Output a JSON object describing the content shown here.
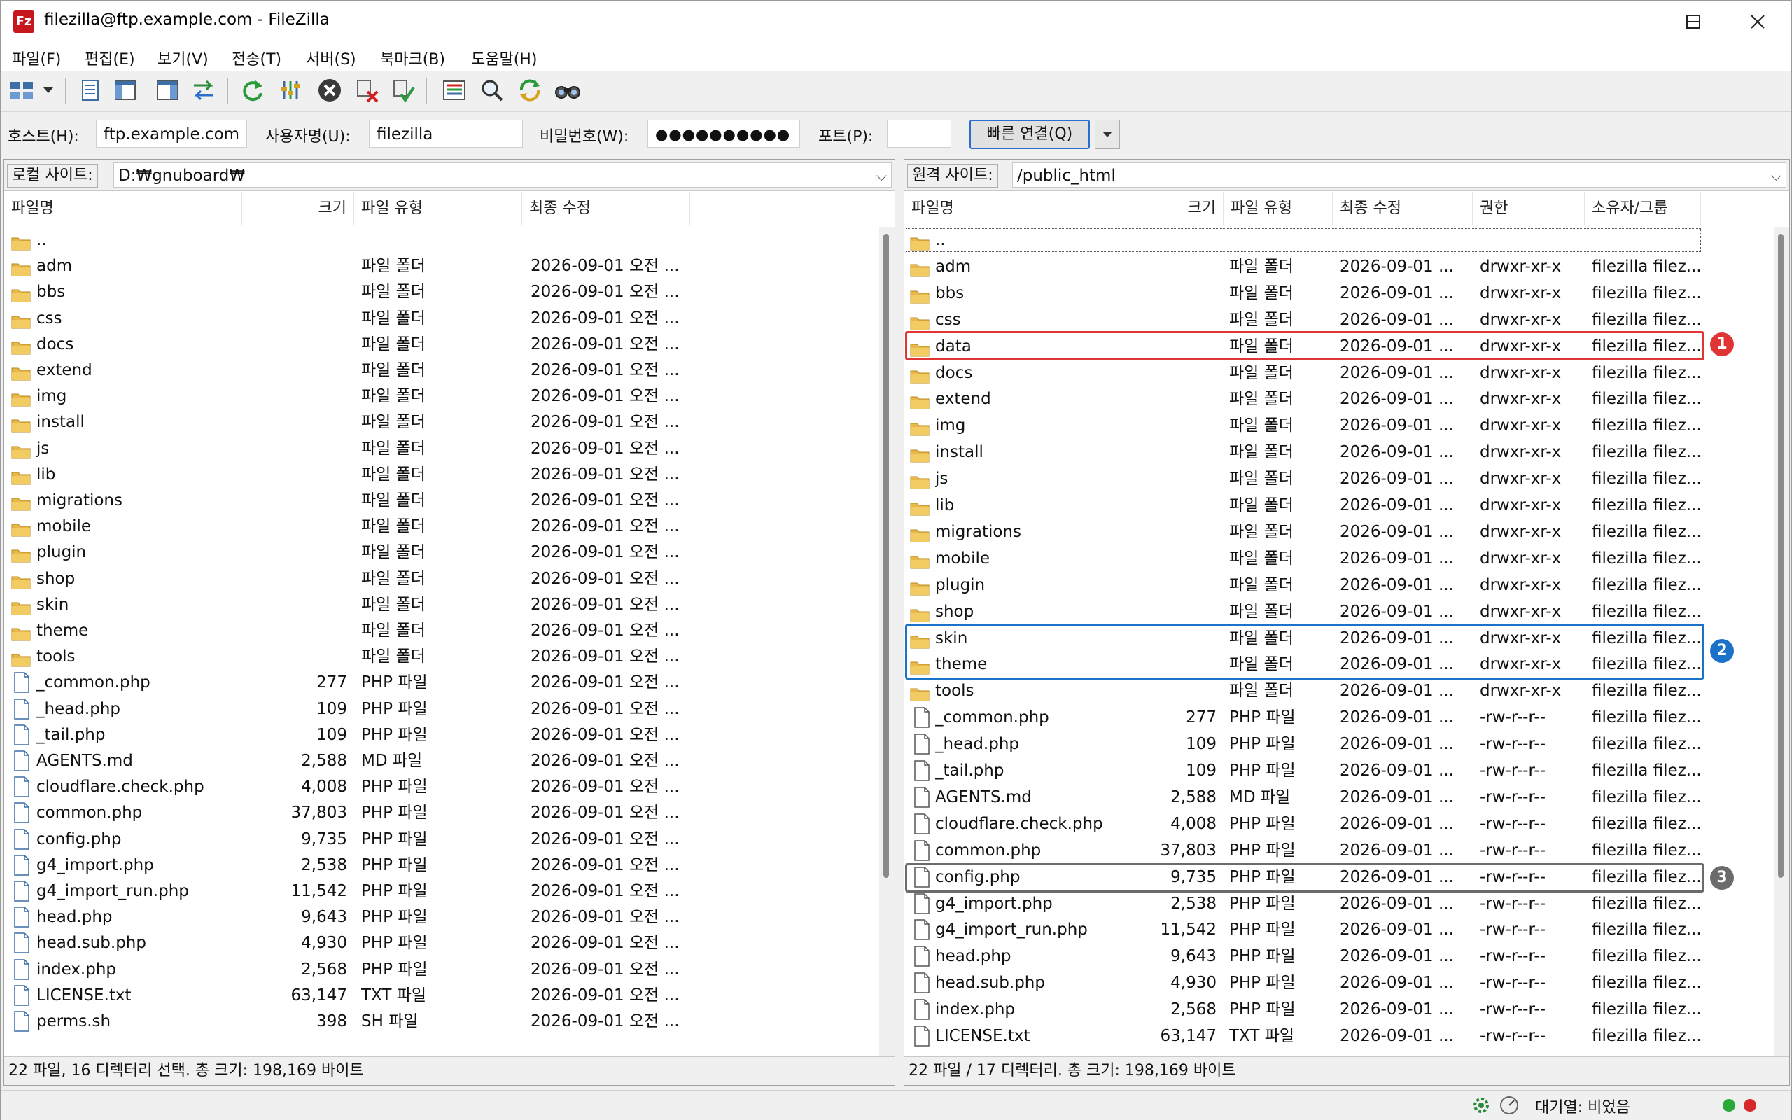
{
  "window": {
    "title": "filezilla@ftp.example.com - FileZilla",
    "app_icon_text": "Fz"
  },
  "menu": [
    "파일(F)",
    "편집(E)",
    "보기(V)",
    "전송(T)",
    "서버(S)",
    "북마크(B)",
    "도움말(H)"
  ],
  "toolbar": {
    "icons": [
      "site-manager-icon",
      "dropdown-arrow-icon",
      "message-log-icon",
      "local-tree-icon",
      "remote-tree-icon",
      "transfer-queue-icon",
      "refresh-icon",
      "filter-icon",
      "cancel-icon",
      "disconnect-icon",
      "reconnect-icon",
      "directory-compare-icon",
      "search-remote-icon",
      "sync-browse-icon",
      "find-files-icon"
    ]
  },
  "quickconnect": {
    "host_label": "호스트(H):",
    "host_value": "ftp.example.com",
    "user_label": "사용자명(U):",
    "user_value": "filezilla",
    "pass_label": "비밀번호(W):",
    "pass_value": "●●●●●●●●●●",
    "port_label": "포트(P):",
    "port_value": "",
    "connect_button": "빠른 연결(Q)"
  },
  "local": {
    "site_label": "로컬 사이트:",
    "path": "D:₩gnuboard₩",
    "columns": [
      "파일명",
      "크기",
      "파일 유형",
      "최종 수정"
    ],
    "rows": [
      {
        "name": "..",
        "type": "",
        "size": "",
        "kind": "",
        "modified": ""
      },
      {
        "name": "adm",
        "type": "folder",
        "size": "",
        "kind": "파일 폴더",
        "modified": "2026-09-01 오전 ..."
      },
      {
        "name": "bbs",
        "type": "folder",
        "size": "",
        "kind": "파일 폴더",
        "modified": "2026-09-01 오전 ..."
      },
      {
        "name": "css",
        "type": "folder",
        "size": "",
        "kind": "파일 폴더",
        "modified": "2026-09-01 오전 ..."
      },
      {
        "name": "docs",
        "type": "folder",
        "size": "",
        "kind": "파일 폴더",
        "modified": "2026-09-01 오전 ..."
      },
      {
        "name": "extend",
        "type": "folder",
        "size": "",
        "kind": "파일 폴더",
        "modified": "2026-09-01 오전 ..."
      },
      {
        "name": "img",
        "type": "folder",
        "size": "",
        "kind": "파일 폴더",
        "modified": "2026-09-01 오전 ..."
      },
      {
        "name": "install",
        "type": "folder",
        "size": "",
        "kind": "파일 폴더",
        "modified": "2026-09-01 오전 ..."
      },
      {
        "name": "js",
        "type": "folder",
        "size": "",
        "kind": "파일 폴더",
        "modified": "2026-09-01 오전 ..."
      },
      {
        "name": "lib",
        "type": "folder",
        "size": "",
        "kind": "파일 폴더",
        "modified": "2026-09-01 오전 ..."
      },
      {
        "name": "migrations",
        "type": "folder",
        "size": "",
        "kind": "파일 폴더",
        "modified": "2026-09-01 오전 ..."
      },
      {
        "name": "mobile",
        "type": "folder",
        "size": "",
        "kind": "파일 폴더",
        "modified": "2026-09-01 오전 ..."
      },
      {
        "name": "plugin",
        "type": "folder",
        "size": "",
        "kind": "파일 폴더",
        "modified": "2026-09-01 오전 ..."
      },
      {
        "name": "shop",
        "type": "folder",
        "size": "",
        "kind": "파일 폴더",
        "modified": "2026-09-01 오전 ..."
      },
      {
        "name": "skin",
        "type": "folder",
        "size": "",
        "kind": "파일 폴더",
        "modified": "2026-09-01 오전 ..."
      },
      {
        "name": "theme",
        "type": "folder",
        "size": "",
        "kind": "파일 폴더",
        "modified": "2026-09-01 오전 ..."
      },
      {
        "name": "tools",
        "type": "folder",
        "size": "",
        "kind": "파일 폴더",
        "modified": "2026-09-01 오전 ..."
      },
      {
        "name": "_common.php",
        "type": "file",
        "size": "277",
        "kind": "PHP 파일",
        "modified": "2026-09-01 오전 ..."
      },
      {
        "name": "_head.php",
        "type": "file",
        "size": "109",
        "kind": "PHP 파일",
        "modified": "2026-09-01 오전 ..."
      },
      {
        "name": "_tail.php",
        "type": "file",
        "size": "109",
        "kind": "PHP 파일",
        "modified": "2026-09-01 오전 ..."
      },
      {
        "name": "AGENTS.md",
        "type": "file",
        "size": "2,588",
        "kind": "MD 파일",
        "modified": "2026-09-01 오전 ..."
      },
      {
        "name": "cloudflare.check.php",
        "type": "file",
        "size": "4,008",
        "kind": "PHP 파일",
        "modified": "2026-09-01 오전 ..."
      },
      {
        "name": "common.php",
        "type": "file",
        "size": "37,803",
        "kind": "PHP 파일",
        "modified": "2026-09-01 오전 ..."
      },
      {
        "name": "config.php",
        "type": "file",
        "size": "9,735",
        "kind": "PHP 파일",
        "modified": "2026-09-01 오전 ..."
      },
      {
        "name": "g4_import.php",
        "type": "file",
        "size": "2,538",
        "kind": "PHP 파일",
        "modified": "2026-09-01 오전 ..."
      },
      {
        "name": "g4_import_run.php",
        "type": "file",
        "size": "11,542",
        "kind": "PHP 파일",
        "modified": "2026-09-01 오전 ..."
      },
      {
        "name": "head.php",
        "type": "file",
        "size": "9,643",
        "kind": "PHP 파일",
        "modified": "2026-09-01 오전 ..."
      },
      {
        "name": "head.sub.php",
        "type": "file",
        "size": "4,930",
        "kind": "PHP 파일",
        "modified": "2026-09-01 오전 ..."
      },
      {
        "name": "index.php",
        "type": "file",
        "size": "2,568",
        "kind": "PHP 파일",
        "modified": "2026-09-01 오전 ..."
      },
      {
        "name": "LICENSE.txt",
        "type": "file",
        "size": "63,147",
        "kind": "TXT 파일",
        "modified": "2026-09-01 오전 ..."
      },
      {
        "name": "perms.sh",
        "type": "file",
        "size": "398",
        "kind": "SH 파일",
        "modified": "2026-09-01 오전 ..."
      }
    ],
    "status": "22 파일, 16 디렉터리 선택. 총 크기: 198,169 바이트"
  },
  "remote": {
    "site_label": "원격 사이트:",
    "path": "/public_html",
    "columns": [
      "파일명",
      "크기",
      "파일 유형",
      "최종 수정",
      "권한",
      "소유자/그룹"
    ],
    "rows": [
      {
        "name": "..",
        "type": "folder",
        "size": "",
        "kind": "",
        "modified": "",
        "perm": "",
        "owner": ""
      },
      {
        "name": "adm",
        "type": "folder",
        "size": "",
        "kind": "파일 폴더",
        "modified": "2026-09-01 ...",
        "perm": "drwxr-xr-x",
        "owner": "filezilla filez..."
      },
      {
        "name": "bbs",
        "type": "folder",
        "size": "",
        "kind": "파일 폴더",
        "modified": "2026-09-01 ...",
        "perm": "drwxr-xr-x",
        "owner": "filezilla filez..."
      },
      {
        "name": "css",
        "type": "folder",
        "size": "",
        "kind": "파일 폴더",
        "modified": "2026-09-01 ...",
        "perm": "drwxr-xr-x",
        "owner": "filezilla filez..."
      },
      {
        "name": "data",
        "type": "folder",
        "size": "",
        "kind": "파일 폴더",
        "modified": "2026-09-01 ...",
        "perm": "drwxr-xr-x",
        "owner": "filezilla filez..."
      },
      {
        "name": "docs",
        "type": "folder",
        "size": "",
        "kind": "파일 폴더",
        "modified": "2026-09-01 ...",
        "perm": "drwxr-xr-x",
        "owner": "filezilla filez..."
      },
      {
        "name": "extend",
        "type": "folder",
        "size": "",
        "kind": "파일 폴더",
        "modified": "2026-09-01 ...",
        "perm": "drwxr-xr-x",
        "owner": "filezilla filez..."
      },
      {
        "name": "img",
        "type": "folder",
        "size": "",
        "kind": "파일 폴더",
        "modified": "2026-09-01 ...",
        "perm": "drwxr-xr-x",
        "owner": "filezilla filez..."
      },
      {
        "name": "install",
        "type": "folder",
        "size": "",
        "kind": "파일 폴더",
        "modified": "2026-09-01 ...",
        "perm": "drwxr-xr-x",
        "owner": "filezilla filez..."
      },
      {
        "name": "js",
        "type": "folder",
        "size": "",
        "kind": "파일 폴더",
        "modified": "2026-09-01 ...",
        "perm": "drwxr-xr-x",
        "owner": "filezilla filez..."
      },
      {
        "name": "lib",
        "type": "folder",
        "size": "",
        "kind": "파일 폴더",
        "modified": "2026-09-01 ...",
        "perm": "drwxr-xr-x",
        "owner": "filezilla filez..."
      },
      {
        "name": "migrations",
        "type": "folder",
        "size": "",
        "kind": "파일 폴더",
        "modified": "2026-09-01 ...",
        "perm": "drwxr-xr-x",
        "owner": "filezilla filez..."
      },
      {
        "name": "mobile",
        "type": "folder",
        "size": "",
        "kind": "파일 폴더",
        "modified": "2026-09-01 ...",
        "perm": "drwxr-xr-x",
        "owner": "filezilla filez..."
      },
      {
        "name": "plugin",
        "type": "folder",
        "size": "",
        "kind": "파일 폴더",
        "modified": "2026-09-01 ...",
        "perm": "drwxr-xr-x",
        "owner": "filezilla filez..."
      },
      {
        "name": "shop",
        "type": "folder",
        "size": "",
        "kind": "파일 폴더",
        "modified": "2026-09-01 ...",
        "perm": "drwxr-xr-x",
        "owner": "filezilla filez..."
      },
      {
        "name": "skin",
        "type": "folder",
        "size": "",
        "kind": "파일 폴더",
        "modified": "2026-09-01 ...",
        "perm": "drwxr-xr-x",
        "owner": "filezilla filez..."
      },
      {
        "name": "theme",
        "type": "folder",
        "size": "",
        "kind": "파일 폴더",
        "modified": "2026-09-01 ...",
        "perm": "drwxr-xr-x",
        "owner": "filezilla filez..."
      },
      {
        "name": "tools",
        "type": "folder",
        "size": "",
        "kind": "파일 폴더",
        "modified": "2026-09-01 ...",
        "perm": "drwxr-xr-x",
        "owner": "filezilla filez..."
      },
      {
        "name": "_common.php",
        "type": "file",
        "size": "277",
        "kind": "PHP 파일",
        "modified": "2026-09-01 ...",
        "perm": "-rw-r--r--",
        "owner": "filezilla filez..."
      },
      {
        "name": "_head.php",
        "type": "file",
        "size": "109",
        "kind": "PHP 파일",
        "modified": "2026-09-01 ...",
        "perm": "-rw-r--r--",
        "owner": "filezilla filez..."
      },
      {
        "name": "_tail.php",
        "type": "file",
        "size": "109",
        "kind": "PHP 파일",
        "modified": "2026-09-01 ...",
        "perm": "-rw-r--r--",
        "owner": "filezilla filez..."
      },
      {
        "name": "AGENTS.md",
        "type": "file",
        "size": "2,588",
        "kind": "MD 파일",
        "modified": "2026-09-01 ...",
        "perm": "-rw-r--r--",
        "owner": "filezilla filez..."
      },
      {
        "name": "cloudflare.check.php",
        "type": "file",
        "size": "4,008",
        "kind": "PHP 파일",
        "modified": "2026-09-01 ...",
        "perm": "-rw-r--r--",
        "owner": "filezilla filez..."
      },
      {
        "name": "common.php",
        "type": "file",
        "size": "37,803",
        "kind": "PHP 파일",
        "modified": "2026-09-01 ...",
        "perm": "-rw-r--r--",
        "owner": "filezilla filez..."
      },
      {
        "name": "config.php",
        "type": "file",
        "size": "9,735",
        "kind": "PHP 파일",
        "modified": "2026-09-01 ...",
        "perm": "-rw-r--r--",
        "owner": "filezilla filez..."
      },
      {
        "name": "g4_import.php",
        "type": "file",
        "size": "2,538",
        "kind": "PHP 파일",
        "modified": "2026-09-01 ...",
        "perm": "-rw-r--r--",
        "owner": "filezilla filez..."
      },
      {
        "name": "g4_import_run.php",
        "type": "file",
        "size": "11,542",
        "kind": "PHP 파일",
        "modified": "2026-09-01 ...",
        "perm": "-rw-r--r--",
        "owner": "filezilla filez..."
      },
      {
        "name": "head.php",
        "type": "file",
        "size": "9,643",
        "kind": "PHP 파일",
        "modified": "2026-09-01 ...",
        "perm": "-rw-r--r--",
        "owner": "filezilla filez..."
      },
      {
        "name": "head.sub.php",
        "type": "file",
        "size": "4,930",
        "kind": "PHP 파일",
        "modified": "2026-09-01 ...",
        "perm": "-rw-r--r--",
        "owner": "filezilla filez..."
      },
      {
        "name": "index.php",
        "type": "file",
        "size": "2,568",
        "kind": "PHP 파일",
        "modified": "2026-09-01 ...",
        "perm": "-rw-r--r--",
        "owner": "filezilla filez..."
      },
      {
        "name": "LICENSE.txt",
        "type": "file",
        "size": "63,147",
        "kind": "TXT 파일",
        "modified": "2026-09-01 ...",
        "perm": "-rw-r--r--",
        "owner": "filezilla filez..."
      }
    ],
    "status": "22 파일 / 17 디렉터리. 총 크기: 198,169 바이트"
  },
  "statusbar": {
    "queue": "대기열: 비었음"
  },
  "annotations": [
    {
      "label": "1",
      "color": "#e03535"
    },
    {
      "label": "2",
      "color": "#1a73c8"
    },
    {
      "label": "3",
      "color": "#6b6b6b"
    }
  ]
}
